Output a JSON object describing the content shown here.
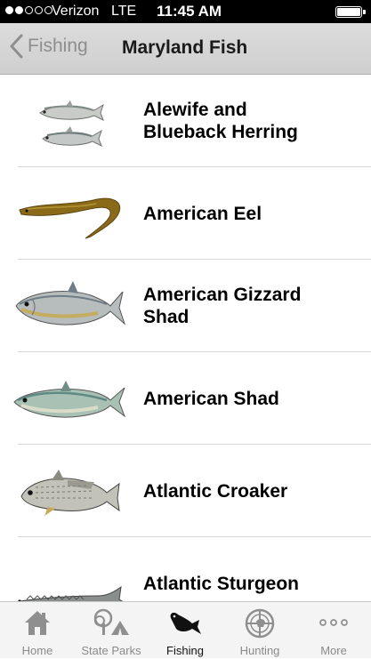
{
  "status_bar": {
    "carrier": "Verizon",
    "network": "LTE",
    "time": "11:45 AM",
    "signal_bars_filled": 2,
    "signal_bars_total": 5
  },
  "nav": {
    "back_label": "Fishing",
    "title": "Maryland Fish"
  },
  "fish": [
    {
      "name": "Alewife and\nBlueback Herring",
      "icon": "herring-image"
    },
    {
      "name": "American Eel",
      "icon": "eel-image"
    },
    {
      "name": "American Gizzard\nShad",
      "icon": "gizzard-shad-image"
    },
    {
      "name": "American Shad",
      "icon": "american-shad-image"
    },
    {
      "name": "Atlantic Croaker",
      "icon": "croaker-image"
    },
    {
      "name": "Atlantic Sturgeon",
      "icon": "sturgeon-image"
    }
  ],
  "tabs": [
    {
      "label": "Home",
      "icon": "house-icon",
      "active": false
    },
    {
      "label": "State Parks",
      "icon": "tree-tent-icon",
      "active": false
    },
    {
      "label": "Fishing",
      "icon": "fish-icon",
      "active": true
    },
    {
      "label": "Hunting",
      "icon": "crosshair-icon",
      "active": false
    },
    {
      "label": "More",
      "icon": "more-dots-icon",
      "active": false
    }
  ]
}
